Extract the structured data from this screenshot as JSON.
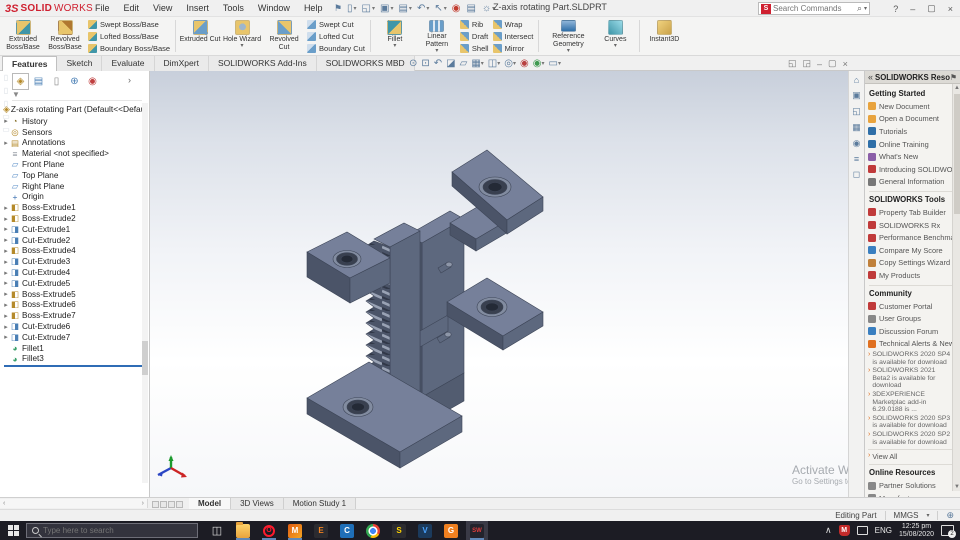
{
  "window": {
    "title": "Z-axis rotating Part.SLDPRT",
    "buttons": {
      "help": "?",
      "min": "–",
      "restore": "▢",
      "close": "×"
    }
  },
  "brand": {
    "logo_mark": "3S",
    "logo_bold": "SOLID",
    "logo_light": "WORKS",
    "accent": "#cf2030"
  },
  "titlebar": {
    "menu": [
      {
        "label": "File"
      },
      {
        "label": "Edit"
      },
      {
        "label": "View"
      },
      {
        "label": "Insert"
      },
      {
        "label": "Tools"
      },
      {
        "label": "Window"
      },
      {
        "label": "Help"
      }
    ],
    "pin_icon": "⚑",
    "quick_icons": [
      {
        "g": "▯",
        "caret": "▾",
        "name": "new-document-icon"
      },
      {
        "g": "◱",
        "caret": "▾",
        "name": "open-icon"
      },
      {
        "g": "▣",
        "caret": "▾",
        "name": "save-icon"
      },
      {
        "g": "▤",
        "caret": "▾",
        "name": "print-icon"
      },
      {
        "g": "↶",
        "caret": "▾",
        "name": "undo-icon"
      },
      {
        "g": "↖",
        "caret": "▾",
        "name": "select-icon"
      },
      {
        "g": "◉",
        "c": "#c23b2e",
        "name": "rebuild-icon"
      },
      {
        "g": "▤",
        "c": "#5b7b9c",
        "name": "file-properties-icon"
      },
      {
        "g": "☼",
        "caret": "▾",
        "c": "#5b7b9c",
        "name": "options-icon"
      }
    ],
    "search": {
      "placeholder": "Search Commands",
      "icon": "S",
      "mag": "⌕"
    }
  },
  "ribbon": {
    "tabs": [
      {
        "label": "Features",
        "cls": "active"
      },
      {
        "label": "Sketch"
      },
      {
        "label": "Evaluate"
      },
      {
        "label": "DimXpert"
      },
      {
        "label": "SOLIDWORKS Add-Ins"
      },
      {
        "label": "SOLIDWORKS MBD"
      }
    ],
    "big": [
      {
        "label": "Extruded Boss/Base",
        "icon": "extruded-boss-icon"
      },
      {
        "label": "Revolved Boss/Base",
        "icon": "revolved-boss-icon"
      },
      {
        "label": "Extruded Cut",
        "icon": "extruded-cut-icon"
      },
      {
        "label": "Hole Wizard",
        "icon": "hole-wizard-icon",
        "caret": "▾"
      },
      {
        "label": "Revolved Cut",
        "icon": "revolved-cut-icon"
      },
      {
        "label": "Fillet",
        "icon": "fillet-icon",
        "caret": "▾"
      },
      {
        "label": "Linear Pattern",
        "icon": "linear-pattern-icon",
        "caret": "▾"
      },
      {
        "label": "Reference Geometry",
        "icon": "reference-geometry-icon",
        "caret": "▾"
      },
      {
        "label": "Curves",
        "icon": "curves-icon",
        "caret": "▾"
      },
      {
        "label": "Instant3D",
        "icon": "instant3d-icon"
      }
    ],
    "stack1": [
      {
        "label": "Swept Boss/Base"
      },
      {
        "label": "Lofted Boss/Base"
      },
      {
        "label": "Boundary Boss/Base"
      }
    ],
    "stack2": [
      {
        "label": "Swept Cut"
      },
      {
        "label": "Lofted Cut"
      },
      {
        "label": "Boundary Cut"
      }
    ],
    "stack3": [
      {
        "label": "Rib"
      },
      {
        "label": "Draft"
      },
      {
        "label": "Shell"
      }
    ],
    "stack4": [
      {
        "label": "Wrap"
      },
      {
        "label": "Intersect"
      },
      {
        "label": "Mirror"
      }
    ]
  },
  "headsup": {
    "icons": [
      {
        "g": "⊙",
        "name": "zoom-to-fit-icon"
      },
      {
        "g": "⊡",
        "name": "zoom-to-area-icon"
      },
      {
        "g": "↶",
        "name": "previous-view-icon"
      },
      {
        "g": "◪",
        "name": "section-view-icon"
      },
      {
        "g": "▱",
        "name": "dynamic-annotation-icon"
      },
      {
        "g": "▦",
        "caret": "▾",
        "name": "view-orientation-icon"
      },
      {
        "g": "◫",
        "caret": "▾",
        "name": "display-style-icon"
      },
      {
        "g": "◎",
        "caret": "▾",
        "name": "hide-show-items-icon"
      },
      {
        "g": "◉",
        "c": "#b84040",
        "name": "edit-appearance-icon"
      },
      {
        "g": "◉",
        "c": "#3f9a50",
        "caret": "▾",
        "name": "apply-scene-icon"
      },
      {
        "g": "▭",
        "caret": "▾",
        "name": "view-settings-icon"
      }
    ],
    "doc_window_icons": [
      {
        "g": "◱"
      },
      {
        "g": "◲"
      },
      {
        "g": "–"
      },
      {
        "g": "▢"
      },
      {
        "g": "×"
      }
    ]
  },
  "panel": {
    "header_tabs": [
      {
        "g": "◈",
        "c": "#b58a2a",
        "cls": "active",
        "name": "featuremanager-tab"
      },
      {
        "g": "▤",
        "c": "#4a7fb5",
        "name": "propertymanager-tab"
      },
      {
        "g": "▯",
        "c": "#888888",
        "name": "configurationmanager-tab"
      },
      {
        "g": "⊕",
        "c": "#4a7fb5",
        "name": "dimxpertmanager-tab"
      },
      {
        "g": "◉",
        "c": "#c04040",
        "name": "displaymanager-tab"
      }
    ],
    "chevron": "›",
    "filter_icon": "▼",
    "root_label": "Z-axis rotating Part (Default<<Default>_",
    "items": [
      {
        "arrow": "▸",
        "g": "◔",
        "c": "#8a7430",
        "label": "History"
      },
      {
        "arrow": "",
        "g": "◎",
        "c": "#b58a2a",
        "label": "Sensors"
      },
      {
        "arrow": "▸",
        "g": "▤",
        "c": "#b58a2a",
        "label": "Annotations"
      },
      {
        "arrow": "",
        "g": "≡",
        "c": "#8a8f98",
        "label": "Material <not specified>"
      },
      {
        "arrow": "",
        "g": "▱",
        "c": "#5b8fc9",
        "label": "Front Plane"
      },
      {
        "arrow": "",
        "g": "▱",
        "c": "#5b8fc9",
        "label": "Top Plane"
      },
      {
        "arrow": "",
        "g": "▱",
        "c": "#5b8fc9",
        "label": "Right Plane"
      },
      {
        "arrow": "",
        "g": "+",
        "c": "#3a6fb0",
        "label": "Origin"
      },
      {
        "arrow": "▸",
        "g": "◧",
        "c": "#b58a2a",
        "label": "Boss-Extrude1"
      },
      {
        "arrow": "▸",
        "g": "◧",
        "c": "#b58a2a",
        "label": "Boss-Extrude2"
      },
      {
        "arrow": "▸",
        "g": "◨",
        "c": "#4a7fb5",
        "label": "Cut-Extrude1"
      },
      {
        "arrow": "▸",
        "g": "◨",
        "c": "#4a7fb5",
        "label": "Cut-Extrude2"
      },
      {
        "arrow": "▸",
        "g": "◧",
        "c": "#b58a2a",
        "label": "Boss-Extrude4"
      },
      {
        "arrow": "▸",
        "g": "◨",
        "c": "#4a7fb5",
        "label": "Cut-Extrude3"
      },
      {
        "arrow": "▸",
        "g": "◨",
        "c": "#4a7fb5",
        "label": "Cut-Extrude4"
      },
      {
        "arrow": "▸",
        "g": "◨",
        "c": "#4a7fb5",
        "label": "Cut-Extrude5"
      },
      {
        "arrow": "▸",
        "g": "◧",
        "c": "#b58a2a",
        "label": "Boss-Extrude5"
      },
      {
        "arrow": "▸",
        "g": "◧",
        "c": "#b58a2a",
        "label": "Boss-Extrude6"
      },
      {
        "arrow": "▸",
        "g": "◧",
        "c": "#b58a2a",
        "label": "Boss-Extrude7"
      },
      {
        "arrow": "▸",
        "g": "◨",
        "c": "#4a7fb5",
        "label": "Cut-Extrude6"
      },
      {
        "arrow": "▸",
        "g": "◨",
        "c": "#4a7fb5",
        "label": "Cut-Extrude7"
      },
      {
        "arrow": "",
        "g": "◕",
        "c": "#3aa06a",
        "label": "Fillet1"
      },
      {
        "arrow": "",
        "g": "◕",
        "c": "#3aa06a",
        "label": "Fillet3"
      }
    ]
  },
  "viewport": {
    "model_color": "#5d687e",
    "watermark_line1": "Activate Windows",
    "watermark_line2": "Go to Settings to activate Windows."
  },
  "rightstrip": {
    "icons": [
      {
        "g": "⌂",
        "name": "home-tab-icon"
      },
      {
        "g": "▣",
        "name": "design-library-icon"
      },
      {
        "g": "◱",
        "name": "file-explorer-icon"
      },
      {
        "g": "▦",
        "name": "view-palette-icon"
      },
      {
        "g": "◉",
        "name": "appearances-icon"
      },
      {
        "g": "≡",
        "name": "custom-properties-icon"
      },
      {
        "g": "◻",
        "name": "forum-icon"
      }
    ]
  },
  "taskpane": {
    "collapse_icon": "«",
    "header": "SOLIDWORKS Resources",
    "pin_icon": "⚑",
    "sec1_title": "Getting Started",
    "sec1_items": [
      {
        "label": "New Document",
        "c": "#e8a33d"
      },
      {
        "label": "Open a Document",
        "c": "#e8a33d"
      },
      {
        "label": "Tutorials",
        "c": "#2f6fa8"
      },
      {
        "label": "Online Training",
        "c": "#2f6fa8"
      },
      {
        "label": "What's New",
        "c": "#8b5fa8"
      },
      {
        "label": "Introducing SOLIDWORKS",
        "c": "#c03a3a"
      },
      {
        "label": "General Information",
        "c": "#777777"
      }
    ],
    "sec2_title": "SOLIDWORKS Tools",
    "sec2_items": [
      {
        "label": "Property Tab Builder",
        "c": "#c03a3a"
      },
      {
        "label": "SOLIDWORKS Rx",
        "c": "#c03a3a"
      },
      {
        "label": "Performance Benchmark Te",
        "c": "#c03a3a"
      },
      {
        "label": "Compare My Score",
        "c": "#3a7fc0"
      },
      {
        "label": "Copy Settings Wizard",
        "c": "#c0803a"
      },
      {
        "label": "My Products",
        "c": "#c03a3a"
      }
    ],
    "sec3_title": "Community",
    "sec3_items": [
      {
        "label": "Customer Portal",
        "c": "#c03a3a"
      },
      {
        "label": "User Groups",
        "c": "#888888"
      },
      {
        "label": "Discussion Forum",
        "c": "#3a7fc0"
      },
      {
        "label": "Technical Alerts & News",
        "c": "#e07020"
      }
    ],
    "news": [
      {
        "text": "SOLIDWORKS 2020 SP4 is available for download"
      },
      {
        "text": "SOLIDWORKS 2021 Beta2 is available for download"
      },
      {
        "text": "3DEXPERIENCE Marketplac add-in 6.29.0188 is ..."
      },
      {
        "text": "SOLIDWORKS 2020 SP3 is available for download"
      },
      {
        "text": "SOLIDWORKS 2020 SP2 is available for download"
      }
    ],
    "view_all": "View All",
    "sec4_title": "Online Resources",
    "sec4_items": [
      {
        "label": "Partner Solutions",
        "c": "#888888"
      },
      {
        "label": "Manufacturers",
        "c": "#888888"
      }
    ]
  },
  "statusbar": {
    "editing": "Editing Part",
    "units": "MMGS",
    "caret": "▾",
    "globe": "⊕"
  },
  "bottomtabs": {
    "tabs": [
      {
        "label": "Model",
        "cls": "active"
      },
      {
        "label": "3D Views"
      },
      {
        "label": "Motion Study 1"
      }
    ]
  },
  "taskbar": {
    "search_placeholder": "Type here to search",
    "apps": [
      {
        "cls": "tb-taskview",
        "letter": "◫",
        "ind": "",
        "name": "task-view-icon"
      },
      {
        "cls": "tb-explorer",
        "letter": "",
        "ind": "run",
        "name": "file-explorer-icon"
      },
      {
        "cls": "tb-opera",
        "letter": "O",
        "ind": "run",
        "name": "opera-icon"
      },
      {
        "cls": "tb-matlab",
        "letter": "M",
        "ind": "run",
        "name": "matlab-icon"
      },
      {
        "cls": "tb-e",
        "letter": "E",
        "ind": "",
        "name": "e-app-icon"
      },
      {
        "cls": "tb-c",
        "letter": "C",
        "ind": "",
        "name": "c-app-icon"
      },
      {
        "cls": "tb-chrome",
        "letter": "",
        "ind": "",
        "name": "chrome-icon"
      },
      {
        "cls": "tb-s",
        "letter": "S",
        "ind": "",
        "name": "s-app-icon"
      },
      {
        "cls": "tb-v",
        "letter": "V",
        "ind": "",
        "name": "v-app-icon"
      },
      {
        "cls": "tb-g",
        "letter": "G",
        "ind": "",
        "name": "g-app-icon"
      },
      {
        "cls": "tb-sw",
        "letter": "SW",
        "ind": "run",
        "name": "solidworks-icon"
      }
    ],
    "tray": {
      "caret": "∧",
      "shield": "M",
      "lang": "ENG",
      "time": "12:25 pm",
      "date": "15/08/2020",
      "badge": "2"
    }
  }
}
